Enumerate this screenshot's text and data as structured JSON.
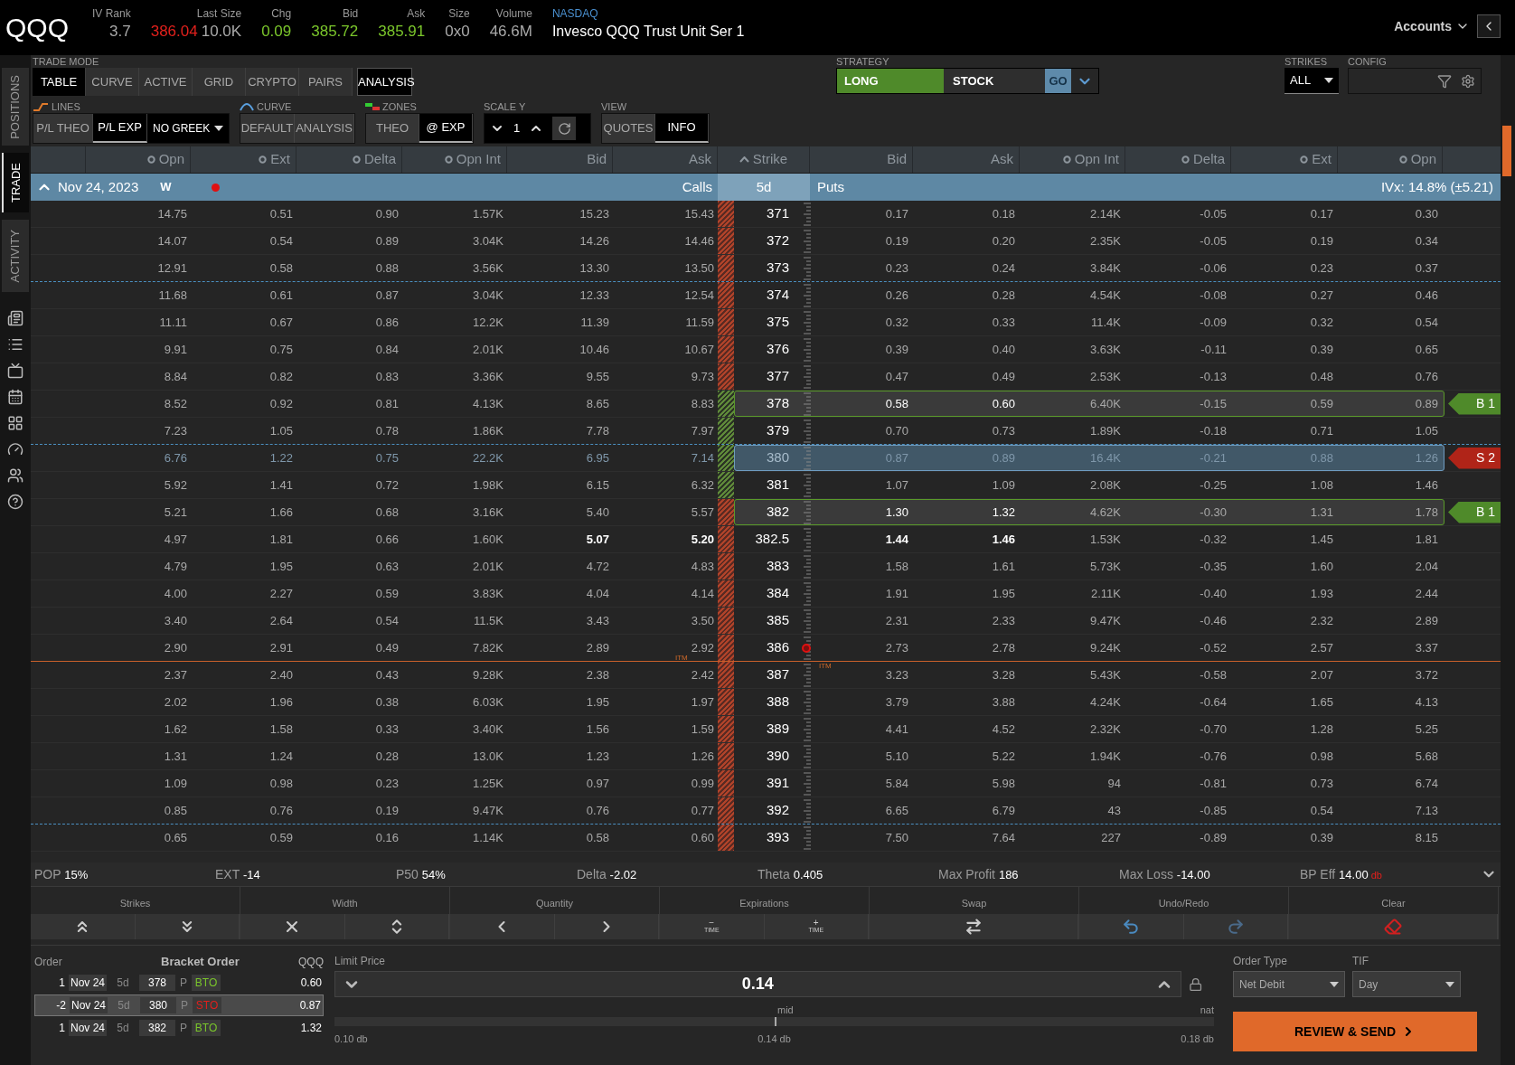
{
  "quote": {
    "symbol": "QQQ",
    "fields": [
      {
        "label": "IV Rank",
        "values": [
          {
            "text": "3.7",
            "color": "#a8a8a8"
          }
        ]
      },
      {
        "label": "Last Size",
        "values": [
          {
            "text": "386.04",
            "color": "#e0201c"
          },
          {
            "text": "10.0K",
            "color": "#a8a8a8"
          }
        ]
      },
      {
        "label": "Chg",
        "values": [
          {
            "text": "0.09",
            "color": "#7ac52b"
          }
        ]
      },
      {
        "label": "Bid",
        "values": [
          {
            "text": "385.72",
            "color": "#7ac52b"
          }
        ]
      },
      {
        "label": "Ask",
        "values": [
          {
            "text": "385.91",
            "color": "#7ac52b"
          }
        ]
      },
      {
        "label": "Size",
        "values": [
          {
            "text": "0x0",
            "color": "#a8a8a8"
          }
        ]
      },
      {
        "label": "Volume",
        "values": [
          {
            "text": "46.6M",
            "color": "#a8a8a8"
          }
        ]
      }
    ],
    "exchange": "NASDAQ",
    "description": "Invesco QQQ Trust Unit Ser 1",
    "accounts": "Accounts"
  },
  "sidebar": [
    {
      "label": "POSITIONS",
      "selected": false
    },
    {
      "label": "TRADE",
      "selected": true
    },
    {
      "label": "ACTIVITY",
      "selected": false
    }
  ],
  "toolbar": {
    "trade_mode": {
      "label": "TRADE MODE",
      "tabs": [
        {
          "label": "TABLE",
          "selected": true
        },
        {
          "label": "CURVE",
          "selected": false
        },
        {
          "label": "ACTIVE",
          "selected": false
        },
        {
          "label": "GRID",
          "selected": false
        },
        {
          "label": "CRYPTO",
          "selected": false
        },
        {
          "label": "PAIRS",
          "selected": false
        }
      ],
      "analysis": {
        "label": "ANALYSIS",
        "on": true
      }
    },
    "lines": {
      "label": "LINES",
      "options": [
        {
          "label": "P/L THEO",
          "selected": false
        },
        {
          "label": "P/L EXP",
          "selected": true
        }
      ],
      "greek": "NO GREEK"
    },
    "curve": {
      "label": "CURVE",
      "options": [
        {
          "label": "DEFAULT",
          "selected": false
        },
        {
          "label": "ANALYSIS",
          "selected": false
        }
      ]
    },
    "zones": {
      "label": "ZONES",
      "options": [
        {
          "label": "THEO",
          "selected": false
        },
        {
          "label": "@ EXP",
          "selected": true
        }
      ]
    },
    "scale_y": {
      "label": "SCALE Y",
      "value": "1"
    },
    "view": {
      "label": "VIEW",
      "options": [
        {
          "label": "QUOTES",
          "selected": false
        },
        {
          "label": "INFO",
          "selected": true
        }
      ]
    },
    "strategy": {
      "label": "STRATEGY",
      "side": "LONG",
      "type": "STOCK",
      "go": "GO"
    },
    "strikes": {
      "label": "STRIKES",
      "value": "ALL"
    },
    "config": {
      "label": "CONFIG"
    }
  },
  "table": {
    "call_columns": [
      {
        "label": "Opn",
        "toggle": true
      },
      {
        "label": "Ext",
        "toggle": true
      },
      {
        "label": "Delta",
        "toggle": true
      },
      {
        "label": "Opn Int",
        "toggle": true
      },
      {
        "label": "Bid",
        "toggle": false
      },
      {
        "label": "Ask",
        "toggle": false
      }
    ],
    "strike_column": "Strike",
    "put_columns": [
      {
        "label": "Bid",
        "toggle": false
      },
      {
        "label": "Ask",
        "toggle": false
      },
      {
        "label": "Opn Int",
        "toggle": true
      },
      {
        "label": "Delta",
        "toggle": true
      },
      {
        "label": "Ext",
        "toggle": true
      },
      {
        "label": "Opn",
        "toggle": true
      }
    ],
    "expiry": {
      "date": "Nov 24, 2023",
      "cycle": "W",
      "expanded": true,
      "alert": true,
      "calls": "Calls",
      "days": "5d",
      "puts": "Puts",
      "ivx": "IVx: 14.8% (±5.21)"
    },
    "rows": [
      {
        "strike": "371",
        "calls": [
          "14.75",
          "0.51",
          "0.90",
          "1.57K",
          "15.23",
          "15.43"
        ],
        "puts": [
          "0.17",
          "0.18",
          "2.14K",
          "-0.05",
          "0.17",
          "0.30"
        ],
        "profit_zone": false,
        "selected": false
      },
      {
        "strike": "372",
        "calls": [
          "14.07",
          "0.54",
          "0.89",
          "3.04K",
          "14.26",
          "14.46"
        ],
        "puts": [
          "0.19",
          "0.20",
          "2.35K",
          "-0.05",
          "0.19",
          "0.34"
        ],
        "profit_zone": false,
        "selected": false
      },
      {
        "strike": "373",
        "calls": [
          "12.91",
          "0.58",
          "0.88",
          "3.56K",
          "13.30",
          "13.50"
        ],
        "puts": [
          "0.23",
          "0.24",
          "3.84K",
          "-0.06",
          "0.23",
          "0.37"
        ],
        "profit_zone": false,
        "selected": false,
        "separator": {
          "kind": "dashed"
        }
      },
      {
        "strike": "374",
        "calls": [
          "11.68",
          "0.61",
          "0.87",
          "3.04K",
          "12.33",
          "12.54"
        ],
        "puts": [
          "0.26",
          "0.28",
          "4.54K",
          "-0.08",
          "0.27",
          "0.46"
        ],
        "profit_zone": false,
        "selected": false
      },
      {
        "strike": "375",
        "calls": [
          "11.11",
          "0.67",
          "0.86",
          "12.2K",
          "11.39",
          "11.59"
        ],
        "puts": [
          "0.32",
          "0.33",
          "11.4K",
          "-0.09",
          "0.32",
          "0.54"
        ],
        "profit_zone": false,
        "selected": false
      },
      {
        "strike": "376",
        "calls": [
          "9.91",
          "0.75",
          "0.84",
          "2.01K",
          "10.46",
          "10.67"
        ],
        "puts": [
          "0.39",
          "0.40",
          "3.63K",
          "-0.11",
          "0.39",
          "0.65"
        ],
        "profit_zone": false,
        "selected": false
      },
      {
        "strike": "377",
        "calls": [
          "8.84",
          "0.82",
          "0.83",
          "3.36K",
          "9.55",
          "9.73"
        ],
        "puts": [
          "0.47",
          "0.49",
          "2.53K",
          "-0.13",
          "0.48",
          "0.76"
        ],
        "profit_zone": false,
        "selected": false
      },
      {
        "strike": "378",
        "calls": [
          "8.52",
          "0.92",
          "0.81",
          "4.13K",
          "8.65",
          "8.83"
        ],
        "puts": [
          "0.58",
          "0.60",
          "6.40K",
          "-0.15",
          "0.59",
          "0.89"
        ],
        "profit_zone": true,
        "selected": false,
        "position": {
          "kind": "buy",
          "label": "B 1"
        }
      },
      {
        "strike": "379",
        "calls": [
          "7.23",
          "1.05",
          "0.78",
          "1.86K",
          "7.78",
          "7.97"
        ],
        "puts": [
          "0.70",
          "0.73",
          "1.89K",
          "-0.18",
          "0.71",
          "1.05"
        ],
        "profit_zone": true,
        "selected": false,
        "separator": {
          "kind": "dashed"
        }
      },
      {
        "strike": "380",
        "calls": [
          "6.76",
          "1.22",
          "0.75",
          "22.2K",
          "6.95",
          "7.14"
        ],
        "puts": [
          "0.87",
          "0.89",
          "16.4K",
          "-0.21",
          "0.88",
          "1.26"
        ],
        "profit_zone": true,
        "selected": true,
        "position": {
          "kind": "sell",
          "label": "S 2"
        }
      },
      {
        "strike": "381",
        "calls": [
          "5.92",
          "1.41",
          "0.72",
          "1.98K",
          "6.15",
          "6.32"
        ],
        "puts": [
          "1.07",
          "1.09",
          "2.08K",
          "-0.25",
          "1.08",
          "1.46"
        ],
        "profit_zone": true,
        "selected": false
      },
      {
        "strike": "382",
        "calls": [
          "5.21",
          "1.66",
          "0.68",
          "3.16K",
          "5.40",
          "5.57"
        ],
        "puts": [
          "1.30",
          "1.32",
          "4.62K",
          "-0.30",
          "1.31",
          "1.78"
        ],
        "profit_zone": false,
        "selected": false,
        "position": {
          "kind": "buy",
          "label": "B 1"
        }
      },
      {
        "strike": "382.5",
        "calls": [
          "4.97",
          "1.81",
          "0.66",
          "1.60K",
          "5.07",
          "5.20"
        ],
        "puts": [
          "1.44",
          "1.46",
          "1.53K",
          "-0.32",
          "1.45",
          "1.81"
        ],
        "profit_zone": false,
        "selected": false,
        "atm": true
      },
      {
        "strike": "383",
        "calls": [
          "4.79",
          "1.95",
          "0.63",
          "2.01K",
          "4.72",
          "4.83"
        ],
        "puts": [
          "1.58",
          "1.61",
          "5.73K",
          "-0.35",
          "1.60",
          "2.04"
        ],
        "profit_zone": false,
        "selected": false
      },
      {
        "strike": "384",
        "calls": [
          "4.00",
          "2.27",
          "0.59",
          "3.83K",
          "4.04",
          "4.14"
        ],
        "puts": [
          "1.91",
          "1.95",
          "2.11K",
          "-0.40",
          "1.93",
          "2.44"
        ],
        "profit_zone": false,
        "selected": false
      },
      {
        "strike": "385",
        "calls": [
          "3.40",
          "2.64",
          "0.54",
          "11.5K",
          "3.43",
          "3.50"
        ],
        "puts": [
          "2.31",
          "2.33",
          "9.47K",
          "-0.46",
          "2.32",
          "2.89"
        ],
        "profit_zone": false,
        "selected": false
      },
      {
        "strike": "386",
        "calls": [
          "2.90",
          "2.91",
          "0.49",
          "7.82K",
          "2.89",
          "2.92"
        ],
        "puts": [
          "2.73",
          "2.78",
          "9.24K",
          "-0.52",
          "2.57",
          "3.37"
        ],
        "profit_zone": false,
        "selected": false,
        "last_price": true,
        "separator": {
          "kind": "itm",
          "call_label": "ITM",
          "put_label": "ITM"
        }
      },
      {
        "strike": "387",
        "calls": [
          "2.37",
          "2.40",
          "0.43",
          "9.28K",
          "2.38",
          "2.42"
        ],
        "puts": [
          "3.23",
          "3.28",
          "5.43K",
          "-0.58",
          "2.07",
          "3.72"
        ],
        "profit_zone": false,
        "selected": false
      },
      {
        "strike": "388",
        "calls": [
          "2.02",
          "1.96",
          "0.38",
          "6.03K",
          "1.95",
          "1.97"
        ],
        "puts": [
          "3.79",
          "3.88",
          "4.24K",
          "-0.64",
          "1.65",
          "4.13"
        ],
        "profit_zone": false,
        "selected": false
      },
      {
        "strike": "389",
        "calls": [
          "1.62",
          "1.58",
          "0.33",
          "3.40K",
          "1.56",
          "1.59"
        ],
        "puts": [
          "4.41",
          "4.52",
          "2.32K",
          "-0.70",
          "1.28",
          "5.25"
        ],
        "profit_zone": false,
        "selected": false
      },
      {
        "strike": "390",
        "calls": [
          "1.31",
          "1.24",
          "0.28",
          "13.0K",
          "1.23",
          "1.26"
        ],
        "puts": [
          "5.10",
          "5.22",
          "1.94K",
          "-0.76",
          "0.98",
          "5.68"
        ],
        "profit_zone": false,
        "selected": false
      },
      {
        "strike": "391",
        "calls": [
          "1.09",
          "0.98",
          "0.23",
          "1.25K",
          "0.97",
          "0.99"
        ],
        "puts": [
          "5.84",
          "5.98",
          "94",
          "-0.81",
          "0.73",
          "6.74"
        ],
        "profit_zone": false,
        "selected": false
      },
      {
        "strike": "392",
        "calls": [
          "0.85",
          "0.76",
          "0.19",
          "9.47K",
          "0.76",
          "0.77"
        ],
        "puts": [
          "6.65",
          "6.79",
          "43",
          "-0.85",
          "0.54",
          "7.13"
        ],
        "profit_zone": false,
        "selected": false,
        "separator": {
          "kind": "dashed"
        }
      },
      {
        "strike": "393",
        "calls": [
          "0.65",
          "0.59",
          "0.16",
          "1.14K",
          "0.58",
          "0.60"
        ],
        "puts": [
          "7.50",
          "7.64",
          "227",
          "-0.89",
          "0.39",
          "8.15"
        ],
        "profit_zone": false,
        "selected": false
      }
    ]
  },
  "stats": [
    {
      "label": "POP",
      "value": "15%"
    },
    {
      "label": "EXT",
      "value": "-14"
    },
    {
      "label": "P50",
      "value": "54%"
    },
    {
      "label": "Delta",
      "value": "-2.02"
    },
    {
      "label": "Theta",
      "value": "0.405"
    },
    {
      "label": "Max Profit",
      "value": "186"
    },
    {
      "label": "Max Loss",
      "value": "-14.00"
    },
    {
      "label": "BP Eff",
      "value": "14.00",
      "unit": "db"
    }
  ],
  "controls": [
    {
      "label": "Strikes",
      "buttons": [
        {
          "kind": "double-up"
        },
        {
          "kind": "double-down"
        }
      ]
    },
    {
      "label": "Width",
      "buttons": [
        {
          "kind": "collapse"
        },
        {
          "kind": "expand"
        }
      ]
    },
    {
      "label": "Quantity",
      "buttons": [
        {
          "kind": "left"
        },
        {
          "kind": "right"
        }
      ]
    },
    {
      "label": "Expirations",
      "buttons": [
        {
          "kind": "time",
          "sign": "−",
          "text": "TIME"
        },
        {
          "kind": "time",
          "sign": "+",
          "text": "TIME"
        }
      ]
    },
    {
      "label": "Swap",
      "buttons": [
        {
          "kind": "swap"
        }
      ]
    },
    {
      "label": "Undo/Redo",
      "buttons": [
        {
          "kind": "undo"
        },
        {
          "kind": "redo"
        }
      ]
    },
    {
      "label": "Clear",
      "buttons": [
        {
          "kind": "clear"
        }
      ]
    }
  ],
  "order": {
    "label": "Order",
    "title": "Bracket Order",
    "symbol": "QQQ",
    "legs": [
      {
        "qty": "1",
        "date": "Nov 24",
        "days": "5d",
        "strike": "378",
        "type": "P",
        "action": "BTO",
        "kind": "buy",
        "price": "0.60",
        "selected": false
      },
      {
        "qty": "-2",
        "date": "Nov 24",
        "days": "5d",
        "strike": "380",
        "type": "P",
        "action": "STO",
        "kind": "sell",
        "price": "0.87",
        "selected": true
      },
      {
        "qty": "1",
        "date": "Nov 24",
        "days": "5d",
        "strike": "382",
        "type": "P",
        "action": "BTO",
        "kind": "buy",
        "price": "1.32",
        "selected": false
      }
    ],
    "limit": {
      "label": "Limit Price",
      "value": "0.14",
      "mid": "mid",
      "nat": "nat",
      "level": 0.5,
      "low": "0.10 db",
      "center": "0.14 db",
      "high": "0.18 db"
    },
    "order_type": {
      "label": "Order Type",
      "value": "Net Debit"
    },
    "tif": {
      "label": "TIF",
      "value": "Day"
    },
    "submit": "REVIEW & SEND"
  }
}
